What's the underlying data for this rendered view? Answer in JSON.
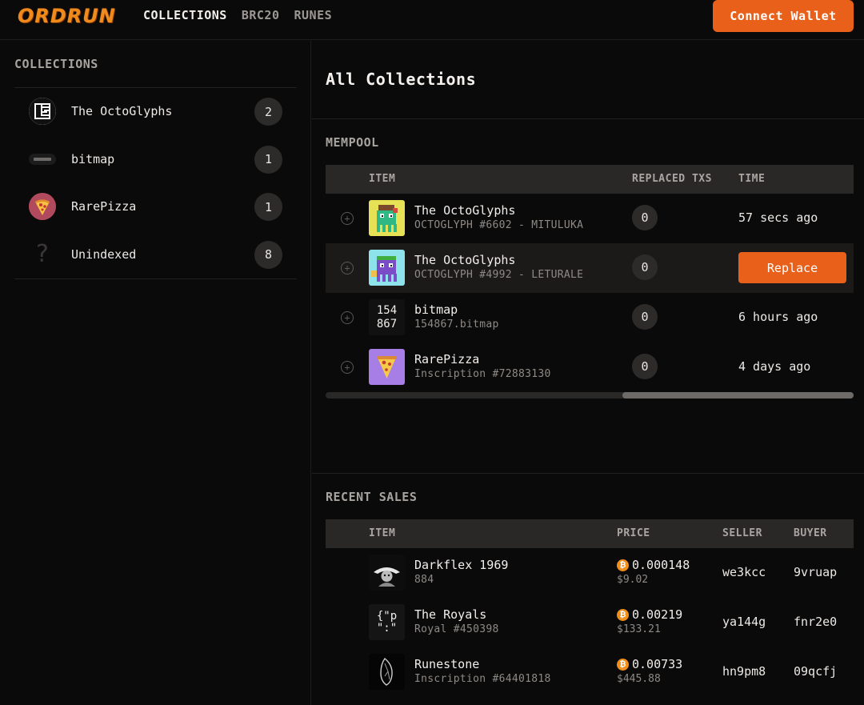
{
  "header": {
    "logo": "ORDRUN",
    "nav": [
      "COLLECTIONS",
      "BRC20",
      "RUNES"
    ],
    "connect_label": "Connect Wallet"
  },
  "sidebar": {
    "title": "COLLECTIONS",
    "items": [
      {
        "label": "The OctoGlyphs",
        "count": "2",
        "icon": "octoglyphs-logo"
      },
      {
        "label": "bitmap",
        "count": "1",
        "icon": "bitmap-logo"
      },
      {
        "label": "RarePizza",
        "count": "1",
        "icon": "pizza-logo"
      },
      {
        "label": "Unindexed",
        "count": "8",
        "icon": "question-mark-icon"
      }
    ]
  },
  "main": {
    "title": "All Collections",
    "mempool": {
      "title": "MEMPOOL",
      "headers": {
        "item": "ITEM",
        "replaced": "REPLACED TXS",
        "time": "TIME"
      },
      "rows": [
        {
          "name": "The OctoGlyphs",
          "sub": "OCTOGLYPH #6602 - MITULUKA",
          "replaced": "0",
          "time": "57 secs ago"
        },
        {
          "name": "The OctoGlyphs",
          "sub": "OCTOGLYPH #4992 - LETURALE",
          "replaced": "0",
          "action": "Replace"
        },
        {
          "name": "bitmap",
          "sub": "154867.bitmap",
          "replaced": "0",
          "time": "6 hours ago",
          "thumb_text_1": "154",
          "thumb_text_2": "867"
        },
        {
          "name": "RarePizza",
          "sub": "Inscription #72883130",
          "replaced": "0",
          "time": "4 days ago"
        }
      ]
    },
    "recent_sales": {
      "title": "RECENT SALES",
      "headers": {
        "item": "ITEM",
        "price": "PRICE",
        "seller": "SELLER",
        "buyer": "BUYER"
      },
      "rows": [
        {
          "name": "Darkflex 1969",
          "sub": "884",
          "price": "0.000148",
          "usd": "$9.02",
          "seller": "we3kcc",
          "buyer": "9vruap"
        },
        {
          "name": "The Royals",
          "sub": "Royal #450398",
          "price": "0.00219",
          "usd": "$133.21",
          "seller": "ya144g",
          "buyer": "fnr2e0",
          "thumb_text_1": "{\"p",
          "thumb_text_2": "\":\""
        },
        {
          "name": "Runestone",
          "sub": "Inscription #64401818",
          "price": "0.00733",
          "usd": "$445.88",
          "seller": "hn9pm8",
          "buyer": "09qcfj"
        }
      ]
    }
  },
  "colors": {
    "accent": "#e8601a",
    "logo": "#ef8a1c",
    "bitcoin": "#f28f1c",
    "background": "#0b0a0a"
  }
}
